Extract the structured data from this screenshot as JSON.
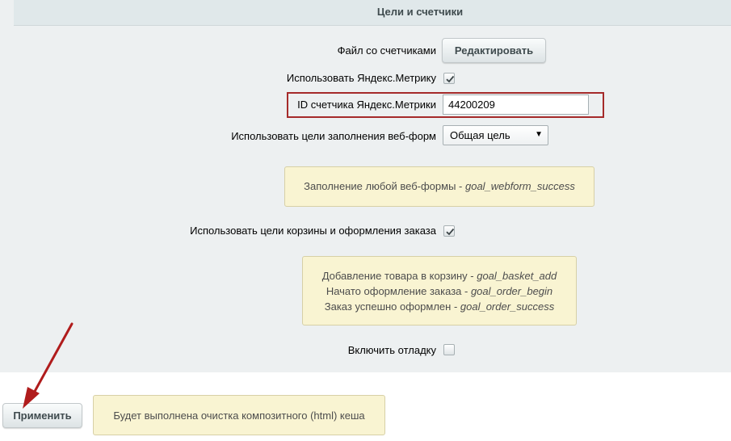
{
  "section": {
    "title": "Цели и счетчики"
  },
  "counters_file": {
    "label": "Файл со счетчиками",
    "edit_button": "Редактировать"
  },
  "yandex_metrika": {
    "label": "Использовать Яндекс.Метрику",
    "checked": true
  },
  "counter_id": {
    "label": "ID счетчика Яндекс.Метрики",
    "value": "44200209"
  },
  "webform_goals": {
    "label": "Использовать цели заполнения веб-форм",
    "selected": "Общая цель",
    "note_text": "Заполнение любой веб-формы - ",
    "note_code": "goal_webform_success"
  },
  "basket_goals": {
    "label": "Использовать цели корзины и оформления заказа",
    "checked": true,
    "notes": [
      {
        "text": "Добавление товара в корзину - ",
        "code": "goal_basket_add"
      },
      {
        "text": "Начато оформление заказа - ",
        "code": "goal_order_begin"
      },
      {
        "text": "Заказ успешно оформлен - ",
        "code": "goal_order_success"
      }
    ]
  },
  "debug": {
    "label": "Включить отладку",
    "checked": false
  },
  "footer": {
    "apply_button": "Применить",
    "cache_note": "Будет выполнена очистка композитного (html) кеша"
  },
  "colors": {
    "annotation_arrow": "#b01c1c",
    "highlight_border": "#a52a2a",
    "note_bg": "#f9f4d2"
  }
}
